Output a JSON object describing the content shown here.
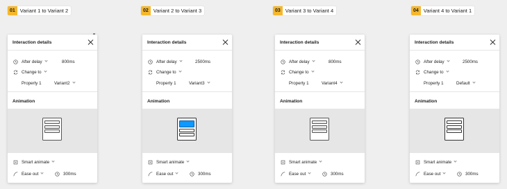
{
  "steps": [
    {
      "num": "01",
      "label": "Variant 1 to Variant 2"
    },
    {
      "num": "02",
      "label": "Variant 2 to Variant 3"
    },
    {
      "num": "03",
      "label": "Variant 3 to Variant 4"
    },
    {
      "num": "04",
      "label": "Variant 4 to Variant 1"
    }
  ],
  "panels": [
    {
      "title": "Interaction details",
      "trigger": "After delay",
      "delay": "800ms",
      "action": "Change to",
      "property": "Property 1",
      "value": "Variant2",
      "animation_label": "Animation",
      "animate": "Smart animate",
      "easing": "Ease out",
      "duration": "300ms"
    },
    {
      "title": "Interaction details",
      "trigger": "After delay",
      "delay": "2500ms",
      "action": "Change to",
      "property": "Property 1",
      "value": "Variant3",
      "animation_label": "Animation",
      "animate": "Smart animate",
      "easing": "Ease out",
      "duration": "300ms"
    },
    {
      "title": "Interaction details",
      "trigger": "After delay",
      "delay": "800ms",
      "action": "Change to",
      "property": "Property 1",
      "value": "Variant4",
      "animation_label": "Animation",
      "animate": "Smart animate",
      "easing": "Ease out",
      "duration": "300ms"
    },
    {
      "title": "Interaction details",
      "trigger": "After delay",
      "delay": "2500ms",
      "action": "Change to",
      "property": "Property 1",
      "value": "Default",
      "animation_label": "Animation",
      "animate": "Smart animate",
      "easing": "Ease out",
      "duration": "300ms"
    }
  ],
  "colors": {
    "step_badge": "#f5b72c",
    "accent": "#0d99ff"
  },
  "icons": [
    "clock-icon",
    "swap-icon",
    "close-icon",
    "smart-animate-icon",
    "ease-curve-icon",
    "timer-icon"
  ]
}
